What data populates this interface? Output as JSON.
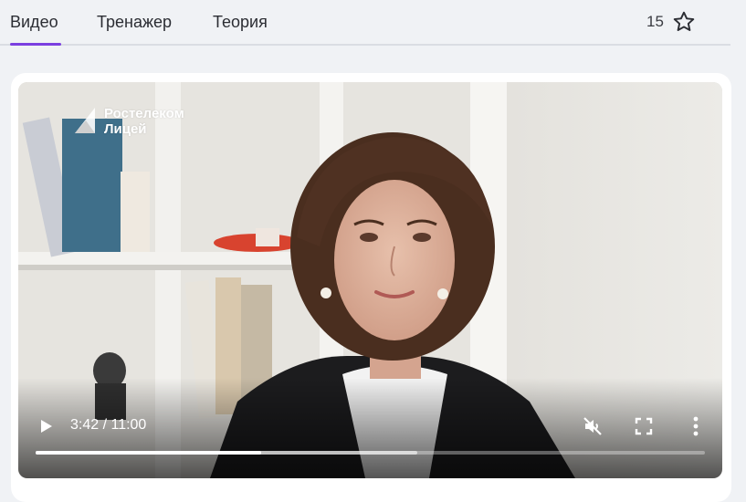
{
  "tabs": [
    {
      "label": "Видео",
      "active": true
    },
    {
      "label": "Тренажер",
      "active": false
    },
    {
      "label": "Теория",
      "active": false
    }
  ],
  "rating": {
    "count": "15",
    "icon": "star-outline-icon"
  },
  "accent_color": "#7b3fe0",
  "video": {
    "logo_line1": "Ростелеком",
    "logo_line2": "Лицей",
    "time_display": "3:42 / 11:00",
    "progress_fraction": 0.3364,
    "buffered_fraction": 0.57,
    "muted": true,
    "controls": [
      "play-icon",
      "mute-icon",
      "fullscreen-icon",
      "more-vertical-icon"
    ]
  }
}
